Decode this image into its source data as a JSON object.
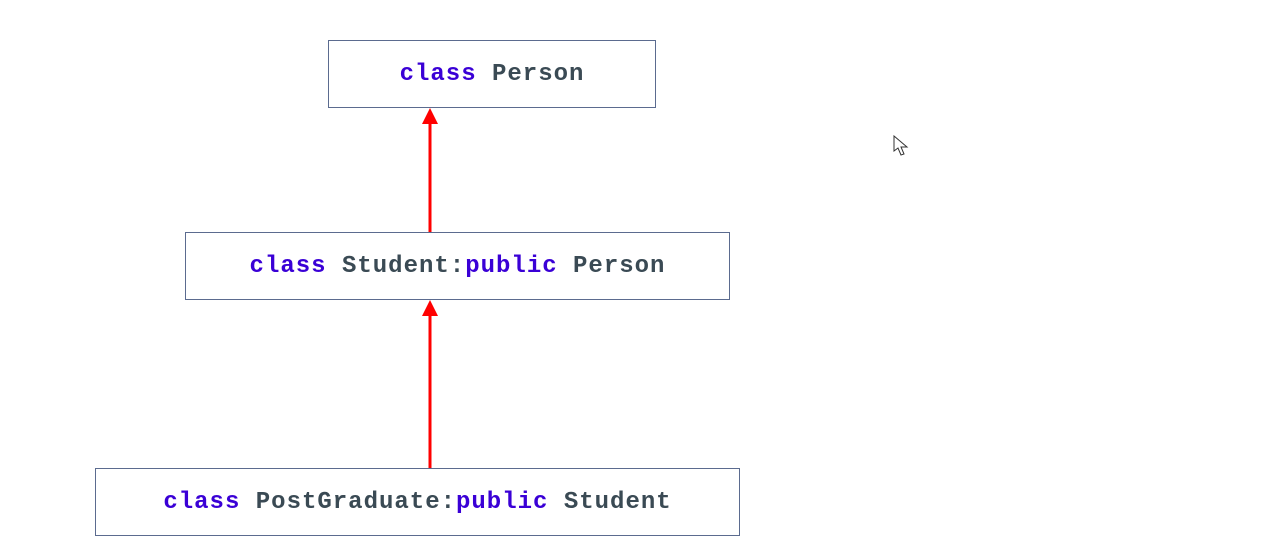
{
  "keyword_class": "class",
  "keyword_public": "public",
  "nodes": {
    "person": {
      "name": "Person"
    },
    "student": {
      "name": "Student",
      "base": "Person"
    },
    "postgraduate": {
      "name": "PostGraduate",
      "base": "Student"
    }
  },
  "colors": {
    "keyword": "#3a00d6",
    "name": "#3a4a54",
    "arrow": "#ff0000",
    "border": "#5b6b8f"
  }
}
